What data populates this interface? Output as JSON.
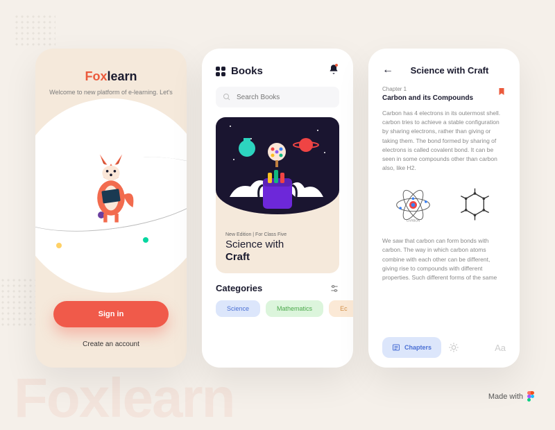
{
  "brand": {
    "prefix": "Fox",
    "suffix": "learn"
  },
  "tagline": "Welcome to new platform of e-learning. Let's learn.",
  "signin_label": "Sign in",
  "create_label": "Create an account",
  "screen2": {
    "title": "Books",
    "search_placeholder": "Search Books",
    "card": {
      "edition": "New Edition | For Class Five",
      "title_line1": "Science with",
      "title_line2": "Craft"
    },
    "categories_label": "Categories",
    "pills": {
      "science": "Science",
      "math": "Mathematics",
      "econ": "Ec"
    }
  },
  "screen3": {
    "title": "Science with Craft",
    "chapter_label": "Chapter 1",
    "chapter_title": "Carbon and its Compounds",
    "para1": "Carbon has 4 electrons in its outermost shell. carbon tries to achieve a stable configuration by sharing electrons, rather than giving or taking them. The bond formed by sharing of electrons is called covalent bond. It can be seen in some compounds other than carbon also, like H2.",
    "atom_label": "CARBON",
    "para2": "We saw that carbon can form bonds with carbon. The way in which carbon atoms combine with each other can be different, giving rise to compounds with different properties. Such different forms of the same",
    "chapters_btn": "Chapters",
    "font_label": "Aa"
  },
  "footer": {
    "madewith": "Made with"
  },
  "bg_text": "Foxlearn"
}
